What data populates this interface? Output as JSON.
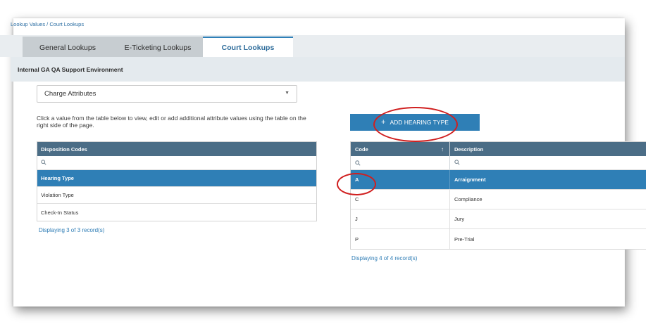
{
  "breadcrumb": "Lookup Values / Court Lookups",
  "tabs": [
    {
      "label": "General Lookups"
    },
    {
      "label": "E-Ticketing Lookups"
    },
    {
      "label": "Court Lookups"
    }
  ],
  "environment": "Internal GA QA Support Environment",
  "select": {
    "value": "Charge Attributes"
  },
  "instructions": "Click a value from the table below to view, edit or add additional attribute values using the table on the right side of the page.",
  "left_table": {
    "header": "Disposition Codes",
    "rows": [
      "Hearing Type",
      "Violation Type",
      "Check-In Status"
    ],
    "count": "Displaying 3 of 3 record(s)"
  },
  "add_button": {
    "label": "ADD HEARING TYPE"
  },
  "right_table": {
    "columns": [
      "Code",
      "Description"
    ],
    "rows": [
      {
        "code": "A",
        "description": "Arraignment"
      },
      {
        "code": "C",
        "description": "Compliance"
      },
      {
        "code": "J",
        "description": "Jury"
      },
      {
        "code": "P",
        "description": "Pre-Trial"
      }
    ],
    "count": "Displaying 4 of 4 record(s)"
  },
  "annotation_color": "#d01f1f"
}
